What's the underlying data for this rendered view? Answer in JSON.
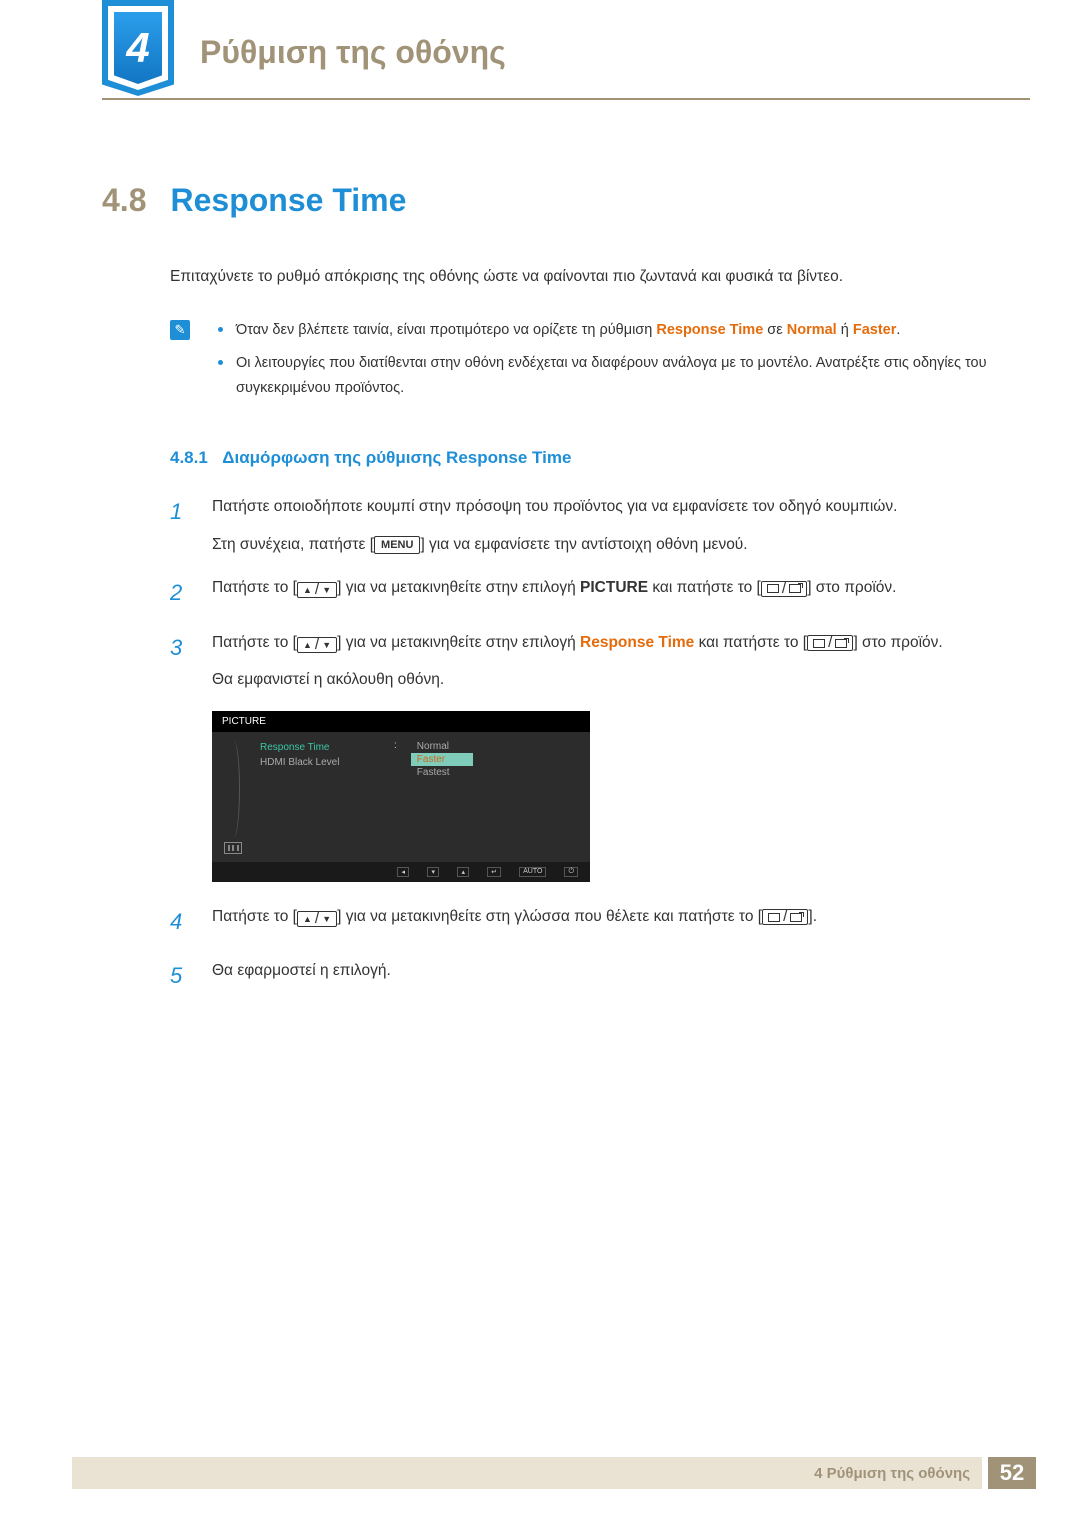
{
  "chapter": {
    "number": "4",
    "title": "Ρύθμιση της οθόνης"
  },
  "section": {
    "number": "4.8",
    "title": "Response Time",
    "intro": "Επιταχύνετε το ρυθμό απόκρισης της οθόνης ώστε να φαίνονται πιο ζωντανά και φυσικά τα βίντεο."
  },
  "notes": {
    "item1_pre": "Όταν δεν βλέπετε ταινία, είναι προτιμότερο να ορίζετε τη ρύθμιση ",
    "item1_kw1": "Response Time",
    "item1_mid": " σε ",
    "item1_kw2": "Normal",
    "item1_or": " ή ",
    "item1_kw3": "Faster",
    "item1_end": ".",
    "item2": "Οι λειτουργίες που διατίθενται στην οθόνη ενδέχεται να διαφέρουν ανάλογα με το μοντέλο. Ανατρέξτε στις οδηγίες του συγκεκριμένου προϊόντος."
  },
  "subsection": {
    "number": "4.8.1",
    "title": "Διαμόρφωση της ρύθμισης Response Time"
  },
  "steps": {
    "s1_num": "1",
    "s1_text": "Πατήστε οποιοδήποτε κουμπί στην πρόσοψη του προϊόντος για να εμφανίσετε τον οδηγό κουμπιών.",
    "s1b_pre": "Στη συνέχεια, πατήστε [",
    "s1b_key": "MENU",
    "s1b_post": "] για να εμφανίσετε την αντίστοιχη οθόνη μενού.",
    "s2_num": "2",
    "s2_pre": "Πατήστε το [",
    "s2_mid": "] για να μετακινηθείτε στην επιλογή ",
    "s2_kw": "PICTURE",
    "s2_mid2": " και πατήστε το [",
    "s2_post": "] στο προϊόν.",
    "s3_num": "3",
    "s3_pre": "Πατήστε το [",
    "s3_mid": "] για να μετακινηθείτε στην επιλογή ",
    "s3_kw": "Response Time",
    "s3_mid2": " και πατήστε το [",
    "s3_post": "] στο προϊόν.",
    "s3_sub": "Θα εμφανιστεί η ακόλουθη οθόνη.",
    "s4_num": "4",
    "s4_pre": "Πατήστε το [",
    "s4_mid": "] για να μετακινηθείτε στη γλώσσα που θέλετε και πατήστε το [",
    "s4_post": "].",
    "s5_num": "5",
    "s5_text": "Θα εφαρμοστεί η επιλογή."
  },
  "osd": {
    "title": "PICTURE",
    "item_active": "Response Time",
    "item2": "HDMI Black Level",
    "colon": ":",
    "opt1": "Normal",
    "opt2": "Faster",
    "opt3": "Fastest",
    "nav_auto": "AUTO"
  },
  "footer": {
    "text": "4 Ρύθμιση της οθόνης",
    "page": "52"
  }
}
